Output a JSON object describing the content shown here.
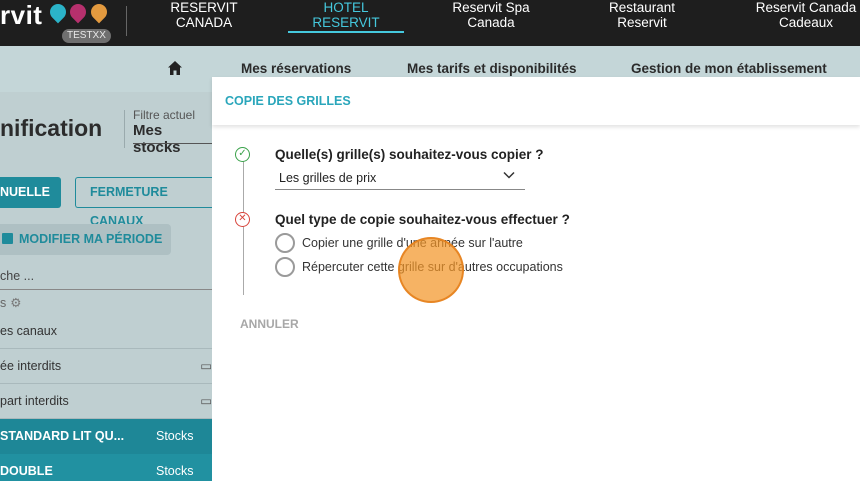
{
  "topbar": {
    "logo_text": "rvit",
    "env_badge": "TESTXX",
    "nav": [
      {
        "line1": "RESERVIT",
        "line2": "CANADA"
      },
      {
        "line1": "HOTEL",
        "line2": "RESERVIT"
      },
      {
        "line1": "Reservit Spa",
        "line2": "Canada"
      },
      {
        "line1": "Restaurant",
        "line2": "Reservit"
      },
      {
        "line1": "Reservit Canada",
        "line2": "Cadeaux"
      }
    ]
  },
  "subnav": {
    "home_icon": "home-icon",
    "items": [
      "Mes réservations",
      "Mes tarifs et disponibilités",
      "Gestion de mon établissement"
    ]
  },
  "background": {
    "title": "nification",
    "filter_label": "Filtre actuel",
    "filter_value": "Mes stocks",
    "btn_annuelle": "NUELLE",
    "btn_fermeture": "FERMETURE CANAUX",
    "btn_periode": "MODIFIER MA PÉRIODE",
    "search": "che ...",
    "s_row": "s",
    "rows": [
      "es canaux",
      "ée interdits",
      "part interdits"
    ],
    "rooms": [
      {
        "name": "STANDARD LIT QU...",
        "stock": "Stocks"
      },
      {
        "name": "DOUBLE",
        "stock": "Stocks"
      }
    ]
  },
  "dialog": {
    "title": "COPIE DES GRILLES",
    "question1": "Quelle(s) grille(s) souhaitez-vous copier ?",
    "select_value": "Les grilles de prix",
    "question2": "Quel type de copie souhaitez-vous effectuer ?",
    "option1": "Copier une grille d'une année sur l'autre",
    "option2": "Répercuter cette grille sur d'autres occupations",
    "cancel": "ANNULER"
  },
  "colors": {
    "accent": "#2aa6bb",
    "nav_active": "#45c8dd",
    "step_done": "#3aa24a",
    "step_error": "#d8443b",
    "click_marker": "#f39628"
  }
}
